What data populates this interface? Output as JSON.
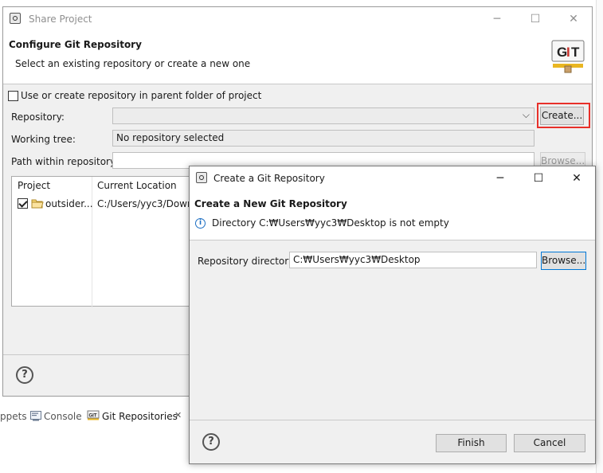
{
  "share_window": {
    "title": "Share Project",
    "header_title": "Configure Git Repository",
    "header_subtitle": "Select an existing repository or create a new one",
    "logo_text": "GIT",
    "use_parent_checkbox_label": "Use or create repository in parent folder of project",
    "repository_label": "Repository:",
    "repository_value": "",
    "create_button": "Create...",
    "working_tree_label": "Working tree:",
    "working_tree_value": "No repository selected",
    "path_label": "Path within repository:",
    "path_value": "",
    "browse_button": "Browse...",
    "table": {
      "columns": [
        "Project",
        "Current Location"
      ],
      "rows": [
        {
          "project": "outsider...",
          "location": "C:/Users/yyc3/Downl"
        }
      ]
    }
  },
  "bottom_tabs": {
    "snippets": "ppets",
    "console": "Console",
    "git_repositories": "Git Repositories"
  },
  "git_dialog": {
    "title": "Create a Git Repository",
    "header_title": "Create a New Git Repository",
    "message": "Directory C:\\Users\\yyc3\\Desktop is not empty",
    "message_display": "Directory C:₩Users₩yyc3₩Desktop is not empty",
    "directory_label": "Repository directory:",
    "directory_value": "C:₩Users₩yyc3₩Desktop",
    "browse_button": "Browse...",
    "finish_button": "Finish",
    "cancel_button": "Cancel"
  },
  "colors": {
    "highlight_box": "#e8302a",
    "focus_border": "#0078d7",
    "dialog_bg": "#f0f0f0"
  }
}
